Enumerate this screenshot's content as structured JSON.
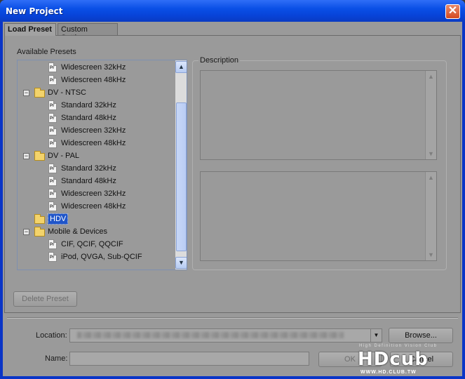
{
  "window": {
    "title": "New Project",
    "close_glyph": "✕"
  },
  "tabs": [
    {
      "label": "Load Preset",
      "active": true
    },
    {
      "label": "Custom Settings",
      "active": false
    }
  ],
  "presets": {
    "label": "Available Presets",
    "file_icon_text": "Pr",
    "rows": [
      {
        "kind": "file",
        "label": "Widescreen 32kHz"
      },
      {
        "kind": "file",
        "label": "Widescreen 48kHz"
      },
      {
        "kind": "folder",
        "label": "DV - NTSC",
        "expander": "−"
      },
      {
        "kind": "file",
        "label": "Standard 32kHz"
      },
      {
        "kind": "file",
        "label": "Standard 48kHz"
      },
      {
        "kind": "file",
        "label": "Widescreen 32kHz"
      },
      {
        "kind": "file",
        "label": "Widescreen 48kHz"
      },
      {
        "kind": "folder",
        "label": "DV - PAL",
        "expander": "−"
      },
      {
        "kind": "file",
        "label": "Standard 32kHz"
      },
      {
        "kind": "file",
        "label": "Standard 48kHz"
      },
      {
        "kind": "file",
        "label": "Widescreen 32kHz"
      },
      {
        "kind": "file",
        "label": "Widescreen 48kHz"
      },
      {
        "kind": "folder",
        "label": "HDV",
        "selected": true
      },
      {
        "kind": "folder",
        "label": "Mobile & Devices",
        "expander": "−"
      },
      {
        "kind": "file",
        "label": "CIF, QCIF, QQCIF"
      },
      {
        "kind": "file",
        "label": "iPod, QVGA, Sub-QCIF"
      }
    ]
  },
  "description": {
    "label": "Description"
  },
  "buttons": {
    "delete_preset": "Delete Preset",
    "browse": "Browse...",
    "ok": "OK",
    "cancel": "Cancel"
  },
  "location": {
    "label": "Location:"
  },
  "name": {
    "label": "Name:",
    "value": ""
  },
  "watermark": {
    "tagline": "High Definition Vision Club",
    "brand": "HDcub",
    "url": "WWW.HD.CLUB.TW"
  },
  "colors": {
    "titlebar": "#0a4fe6",
    "selection": "#1f55c9",
    "dialog_bg": "#9a9a9a"
  }
}
